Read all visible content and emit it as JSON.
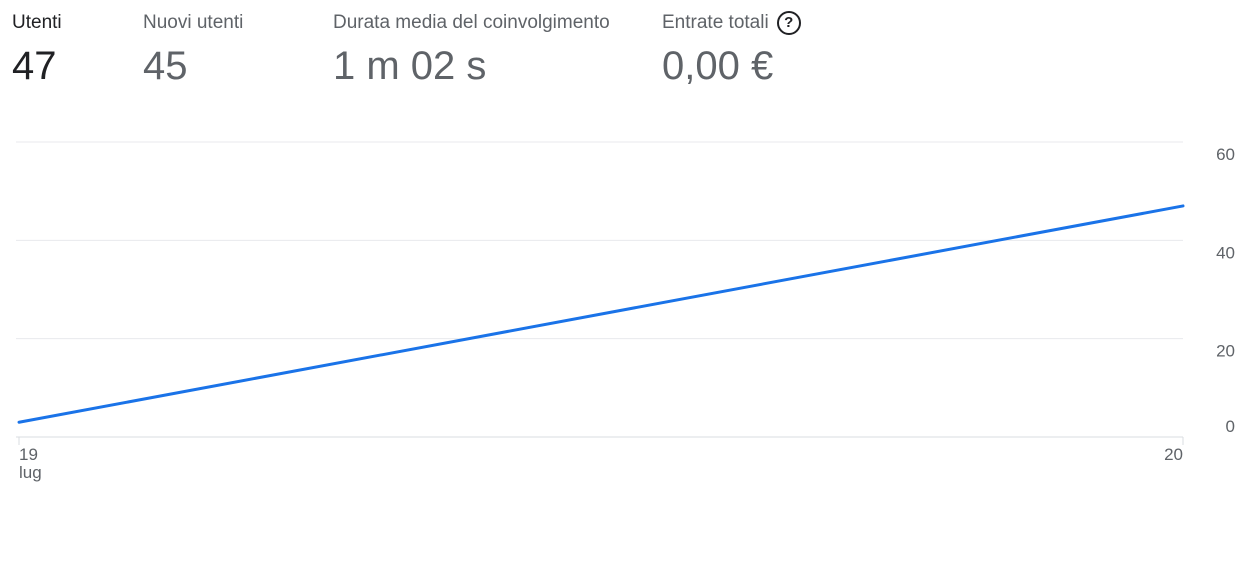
{
  "metrics": [
    {
      "label": "Utenti",
      "value": "47"
    },
    {
      "label": "Nuovi utenti",
      "value": "45"
    },
    {
      "label": "Durata media del coinvolgimento",
      "value": "1 m 02 s"
    },
    {
      "label": "Entrate totali",
      "value": "0,00 €"
    }
  ],
  "help_icon": {
    "glyph": "?",
    "name": "help-icon"
  },
  "chart_data": {
    "type": "line",
    "title": "",
    "xlabel": "",
    "ylabel": "",
    "x": [
      "19 lug",
      "20"
    ],
    "series": [
      {
        "values": [
          3,
          47
        ],
        "color": "#1a73e8"
      }
    ],
    "x_ticks": [
      {
        "line1": "19",
        "line2": "lug"
      },
      {
        "line1": "20",
        "line2": ""
      }
    ],
    "y_ticks": [
      "0",
      "20",
      "40",
      "60"
    ],
    "ylim": [
      0,
      60
    ],
    "grid": true
  }
}
